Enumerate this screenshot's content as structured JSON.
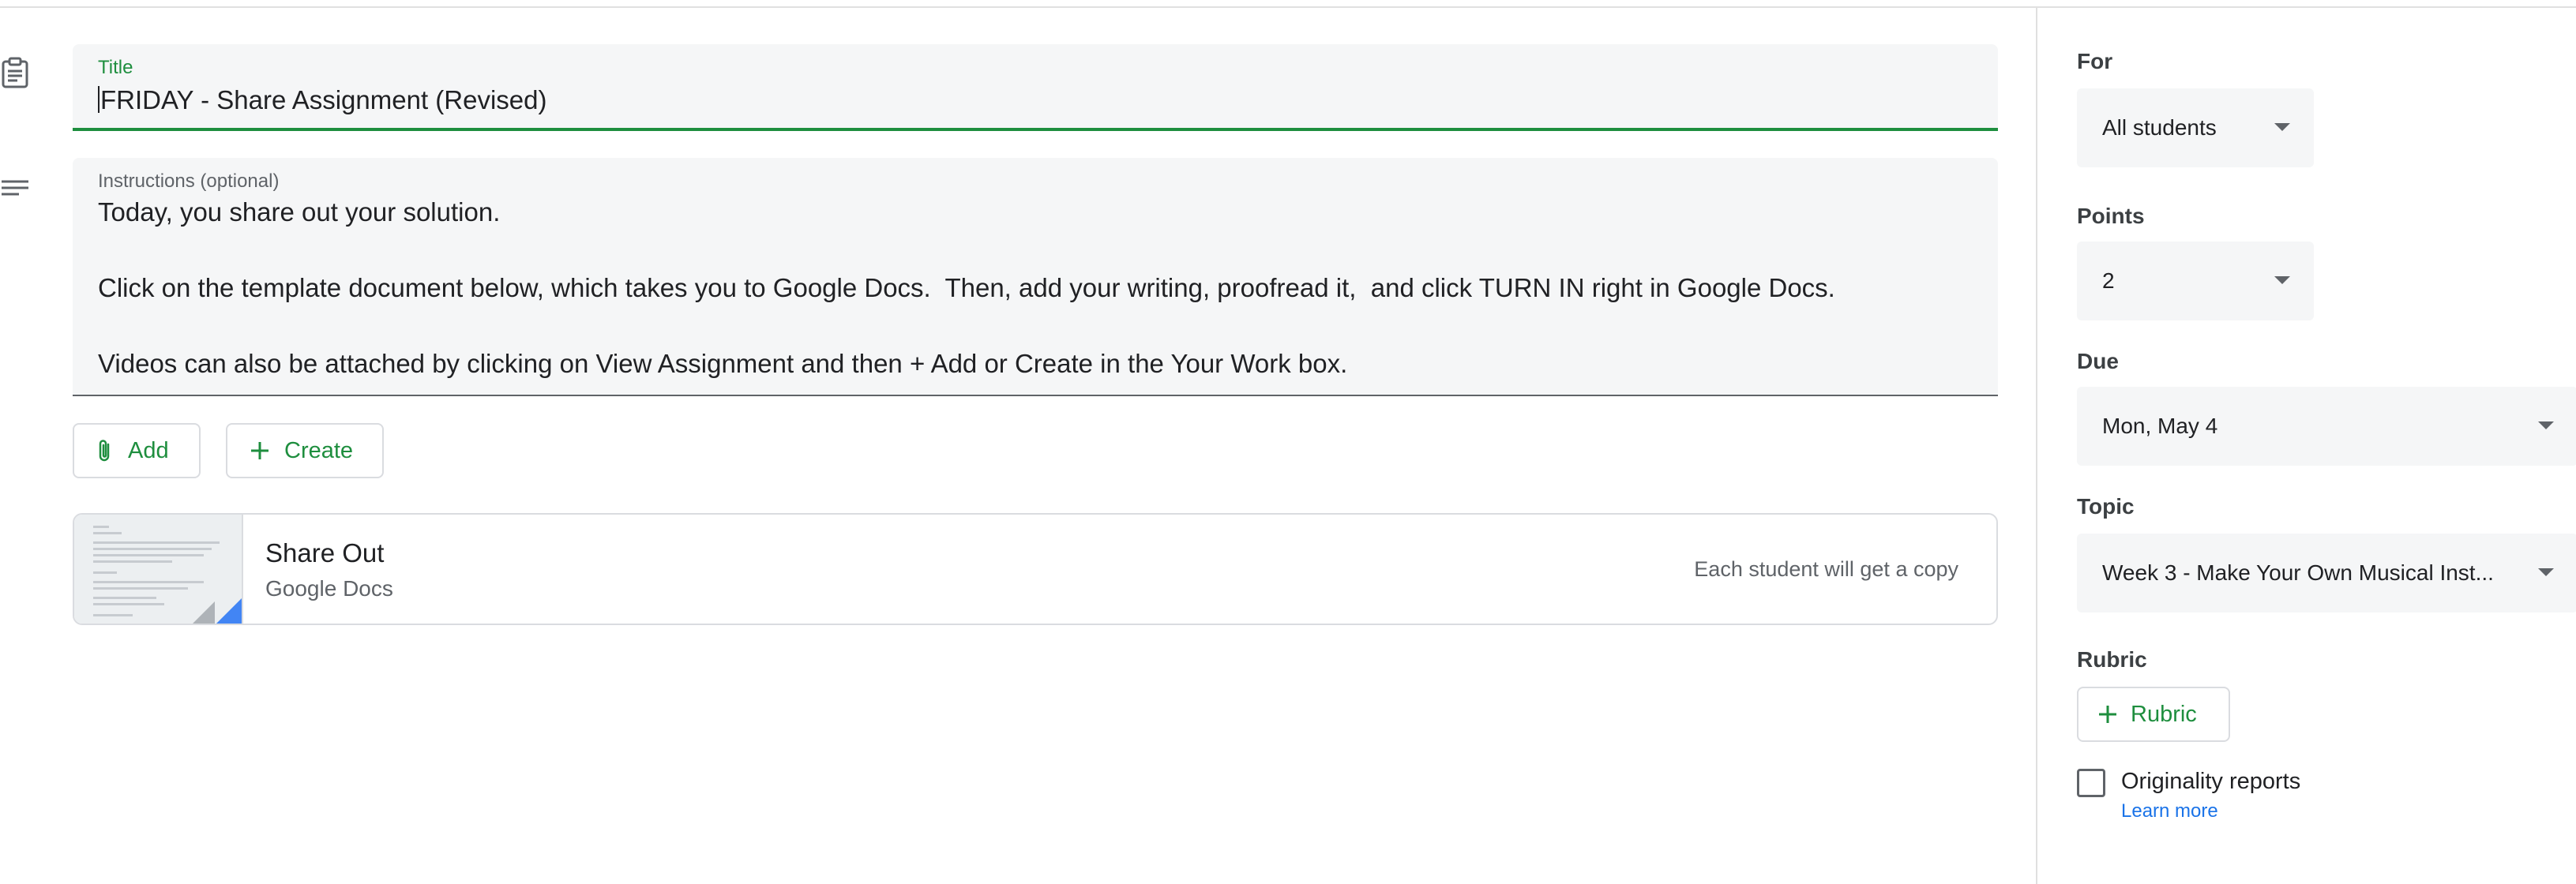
{
  "form": {
    "title_label": "Title",
    "title_value": "FRIDAY - Share Assignment (Revised)",
    "instructions_label": "Instructions (optional)",
    "instructions_lines": [
      "Today, you share out your solution.",
      "",
      "Click on the template document below, which takes you to Google Docs.  Then, add your writing, proofread it,  and click TURN IN right in Google Docs.",
      "",
      "Videos can also be attached by clicking on View Assignment and then + Add or Create in the Your Work box."
    ],
    "add_label": "Add",
    "create_label": "Create"
  },
  "attachment": {
    "title": "Share Out",
    "subtitle": "Google Docs",
    "note": "Each student will get a copy"
  },
  "panel": {
    "for_label": "For",
    "for_value": "All students",
    "points_label": "Points",
    "points_value": "2",
    "due_label": "Due",
    "due_value": "Mon, May 4",
    "topic_label": "Topic",
    "topic_value": "Week 3 - Make Your Own Musical Inst...",
    "rubric_label": "Rubric",
    "rubric_button": "Rubric",
    "originality_label": "Originality reports",
    "learn_more": "Learn more"
  },
  "colors": {
    "accent_green": "#1e8e3e",
    "link_blue": "#1a73e8",
    "field_bg": "#f5f6f7"
  },
  "icons": [
    "assignment-icon",
    "notes-icon",
    "paperclip-icon",
    "plus-icon",
    "dropdown-arrow-icon"
  ]
}
